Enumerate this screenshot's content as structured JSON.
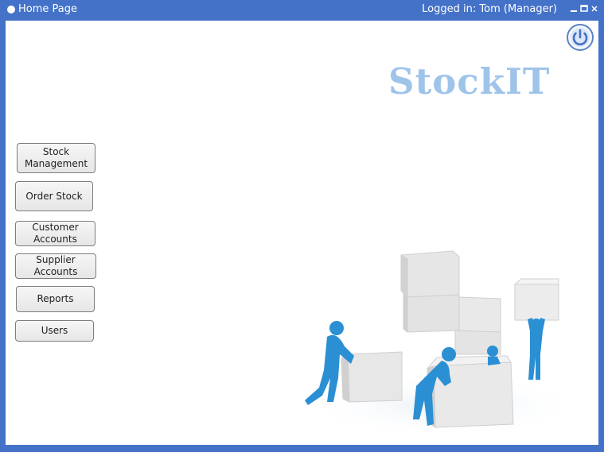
{
  "window": {
    "title": "Home Page",
    "login_status": "Logged in: Tom (Manager)",
    "controls": {
      "minimize_icon": "minimize-icon",
      "maximize_icon": "maximize-icon",
      "close_icon": "close-icon"
    }
  },
  "header": {
    "logo_text": "StockIT",
    "power_icon": "power-icon"
  },
  "nav": {
    "stock_management": "Stock Management",
    "order_stock": "Order Stock",
    "customer_accounts": "Customer Accounts",
    "supplier_accounts": "Supplier Accounts",
    "reports": "Reports",
    "users": "Users"
  },
  "colors": {
    "window_frame": "#4472c8",
    "logo": "#9fc4ea",
    "figure_blue": "#2a8fd3",
    "box_gray": "#e2e2e2"
  }
}
